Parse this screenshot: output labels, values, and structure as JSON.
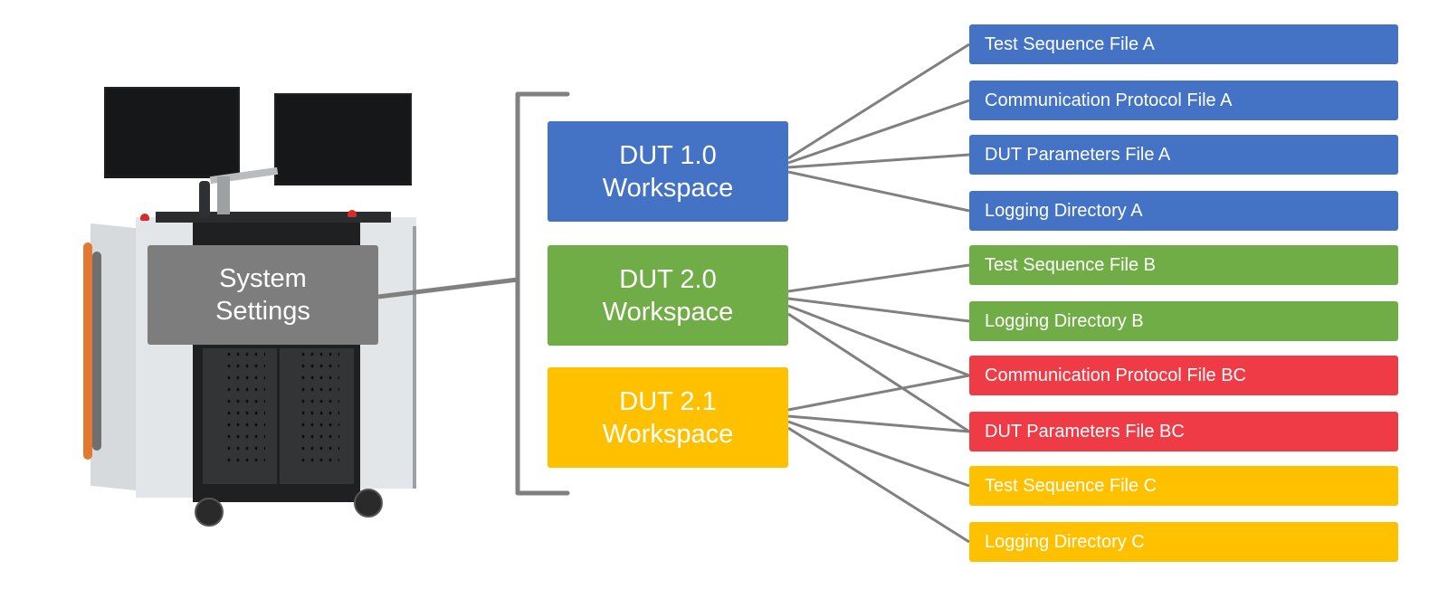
{
  "colors": {
    "blue": "#4472C4",
    "green": "#70AD47",
    "red": "#EE3B45",
    "yellow": "#FFC000",
    "gray_box": "#7D7D7D",
    "connector": "#808080"
  },
  "system_settings": {
    "line1": "System",
    "line2": "Settings"
  },
  "workspaces": [
    {
      "id": "dut10",
      "line1": "DUT 1.0",
      "line2": "Workspace",
      "color": "blue"
    },
    {
      "id": "dut20",
      "line1": "DUT 2.0",
      "line2": "Workspace",
      "color": "green"
    },
    {
      "id": "dut21",
      "line1": "DUT 2.1",
      "line2": "Workspace",
      "color": "yellow"
    }
  ],
  "files": [
    {
      "label": "Test Sequence File A",
      "color": "blue"
    },
    {
      "label": "Communication Protocol File A",
      "color": "blue"
    },
    {
      "label": "DUT Parameters File A",
      "color": "blue"
    },
    {
      "label": "Logging Directory A",
      "color": "blue"
    },
    {
      "label": "Test Sequence File B",
      "color": "green"
    },
    {
      "label": "Logging Directory B",
      "color": "green"
    },
    {
      "label": "Communication Protocol File BC",
      "color": "red"
    },
    {
      "label": "DUT Parameters File BC",
      "color": "red"
    },
    {
      "label": "Test Sequence File C",
      "color": "yellow"
    },
    {
      "label": "Logging Directory C",
      "color": "yellow"
    }
  ],
  "links": [
    {
      "from": "dut10",
      "to": [
        0,
        1,
        2,
        3
      ]
    },
    {
      "from": "dut20",
      "to": [
        4,
        5,
        6,
        7
      ]
    },
    {
      "from": "dut21",
      "to": [
        6,
        7,
        8,
        9
      ]
    }
  ]
}
